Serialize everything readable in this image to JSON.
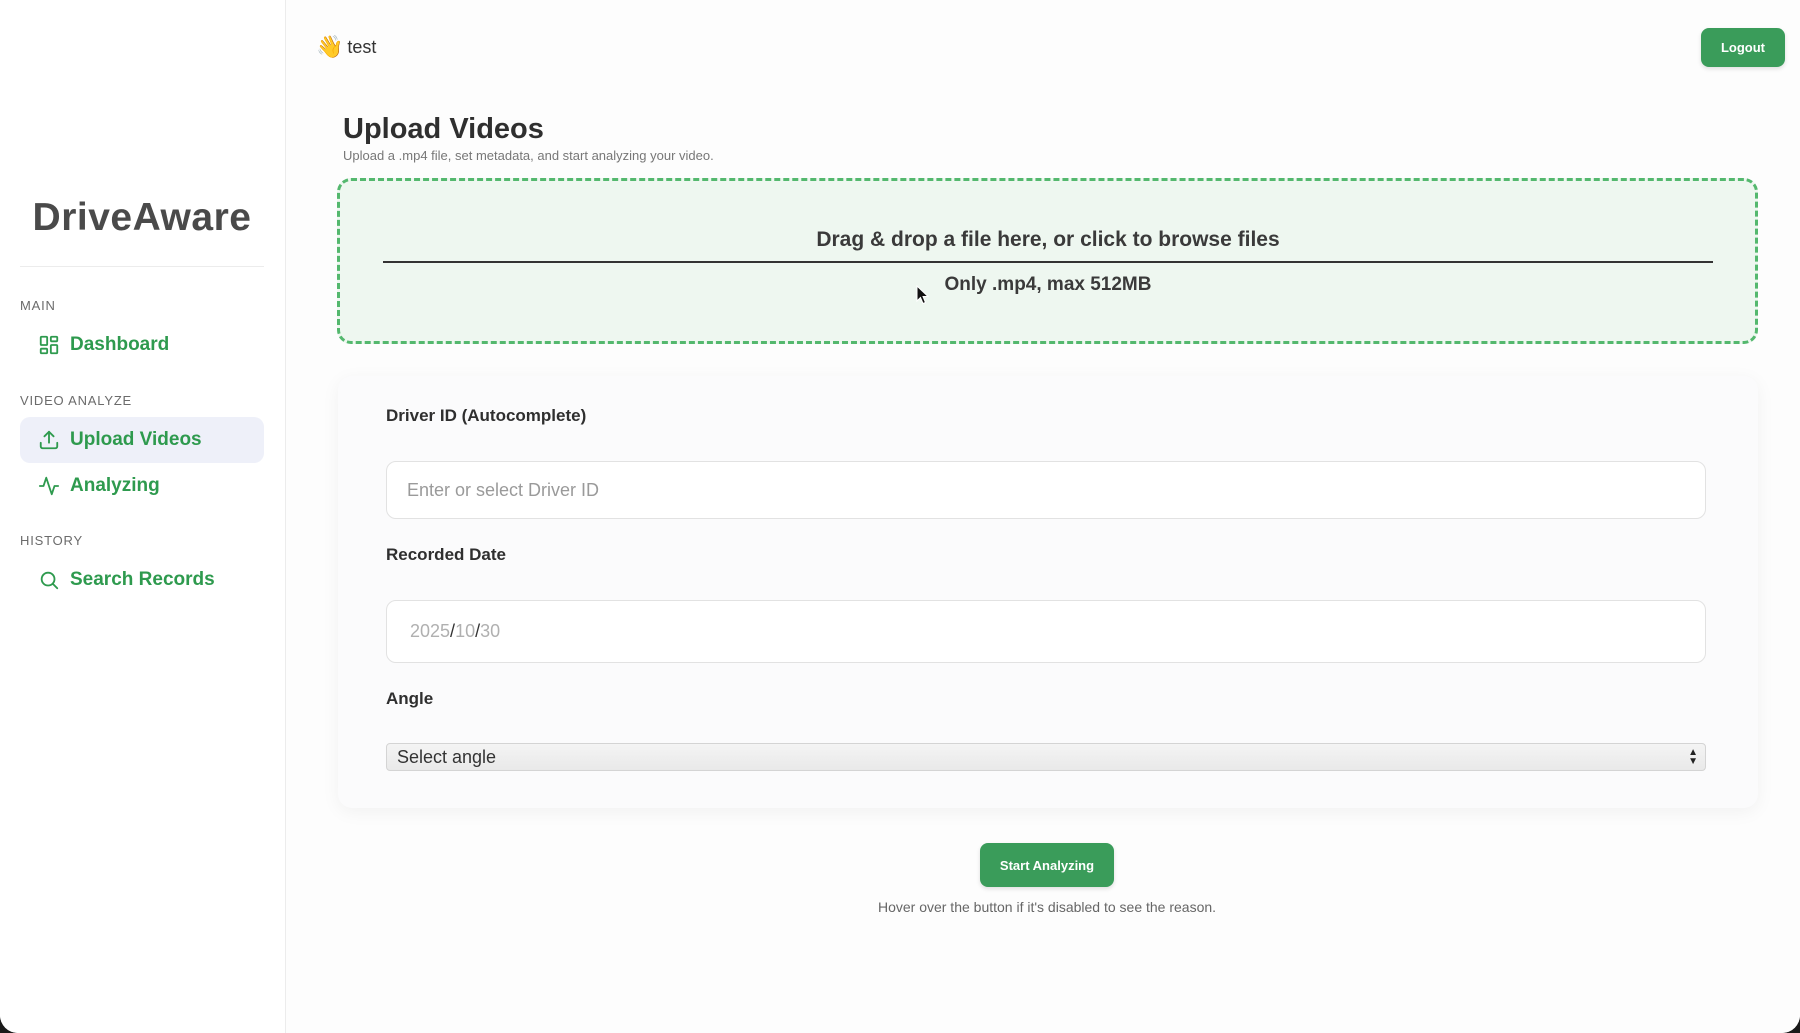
{
  "sidebar": {
    "brand": "DriveAware",
    "sections": [
      {
        "title": "MAIN",
        "items": [
          {
            "label": "Dashboard",
            "icon": "dashboard-grid-icon",
            "active": false
          }
        ]
      },
      {
        "title": "VIDEO ANALYZE",
        "items": [
          {
            "label": "Upload Videos",
            "icon": "upload-icon",
            "active": true
          },
          {
            "label": "Analyzing",
            "icon": "activity-icon",
            "active": false
          }
        ]
      },
      {
        "title": "HISTORY",
        "items": [
          {
            "label": "Search Records",
            "icon": "search-icon",
            "active": false
          }
        ]
      }
    ]
  },
  "header": {
    "greeting_icon": "waving-hand-icon",
    "user": "test",
    "logout_label": "Logout"
  },
  "main": {
    "title": "Upload Videos",
    "subtitle": "Upload a .mp4 file, set metadata, and start analyzing your video.",
    "dropzone": {
      "main_text": "Drag & drop a file here, or click to browse files",
      "hint": "Only .mp4, max 512MB"
    },
    "form": {
      "driver_label": "Driver ID (Autocomplete)",
      "driver_placeholder": "Enter or select Driver ID",
      "date_label": "Recorded Date",
      "date_year": "2025",
      "date_month": "10",
      "date_day": "30",
      "angle_label": "Angle",
      "angle_selected": "Select angle"
    },
    "start_label": "Start Analyzing",
    "hint": "Hover over the button if it's disabled to see the reason."
  },
  "colors": {
    "accent": "#3a9c5a",
    "nav_text": "#2e9a4e",
    "active_nav_bg": "#eef0f9",
    "dropzone_bg": "#eef7f0",
    "dropzone_border": "#54b86e"
  }
}
